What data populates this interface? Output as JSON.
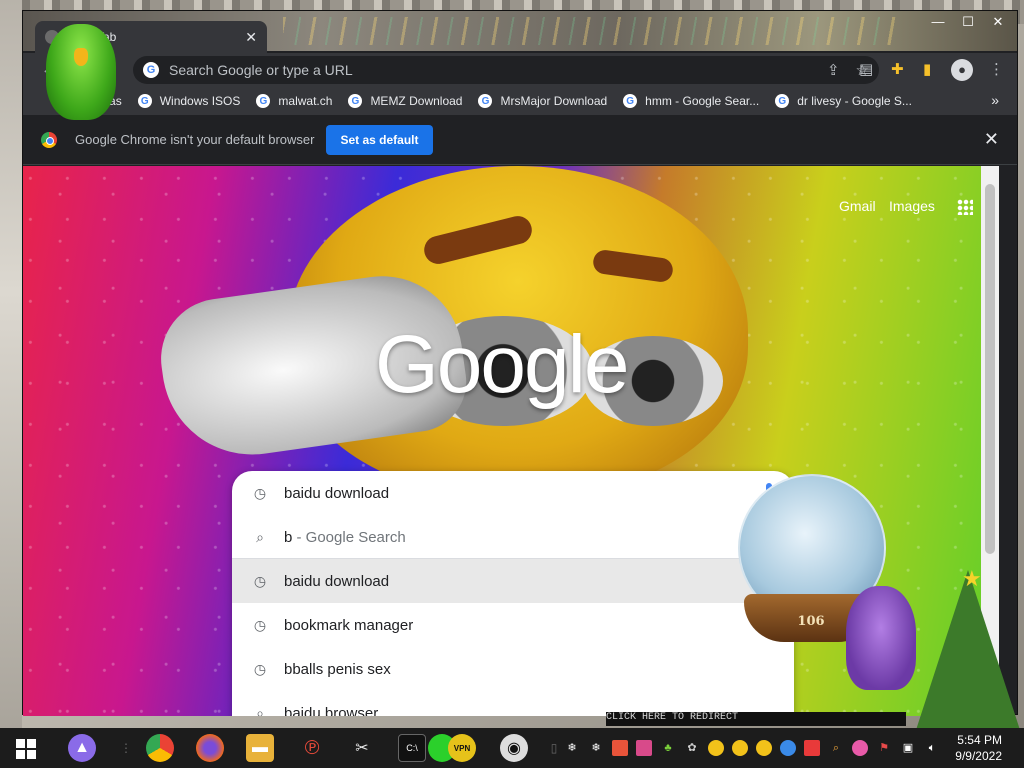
{
  "window": {
    "tab_title": "Tab",
    "tab_close": "✕",
    "minimize": "—",
    "maximize": "☐",
    "close": "✕"
  },
  "toolbar": {
    "omnibox_placeholder": "Search Google or type a URL",
    "share_icon": "share-icon",
    "star_icon": "bookmark-star-icon",
    "extensions_icon": "puzzle-icon"
  },
  "bookmarks": [
    {
      "label": "Databas"
    },
    {
      "label": "Windows ISOS"
    },
    {
      "label": "malwat.ch"
    },
    {
      "label": "MEMZ Download"
    },
    {
      "label": "MrsMajor Download"
    },
    {
      "label": "hmm - Google Sear..."
    },
    {
      "label": "dr livesy - Google S..."
    }
  ],
  "bookmarks_more": "»",
  "infobar": {
    "message": "Google Chrome isn't your default browser",
    "button": "Set as default",
    "close": "✕"
  },
  "page": {
    "gmail": "Gmail",
    "images": "Images",
    "logo": "Google"
  },
  "suggestions": [
    {
      "icon": "history-icon",
      "prefix": "b",
      "text": "aidu download",
      "sub": ""
    },
    {
      "icon": "search-icon",
      "prefix": "b",
      "text": "",
      "sub": " - Google Search"
    },
    {
      "icon": "history-icon",
      "prefix": "b",
      "text": "aidu download",
      "sub": "",
      "highlighted": true
    },
    {
      "icon": "history-icon",
      "prefix": "b",
      "text": "ookmark manager",
      "sub": ""
    },
    {
      "icon": "history-icon",
      "prefix": "b",
      "text": "balls penis sex",
      "sub": ""
    },
    {
      "icon": "search-icon",
      "prefix": "b",
      "text": "aidu browser",
      "sub": ""
    }
  ],
  "desktop": {
    "globe_label": "106",
    "marquee": "CLICK HERE TO REDIRECT"
  },
  "taskbar": {
    "time": "5:54 PM",
    "date": "9/9/2022"
  },
  "colors": {
    "accent": "#1a73e8",
    "chrome_dark": "#35363a",
    "taskbar": "#1c1c1c"
  }
}
